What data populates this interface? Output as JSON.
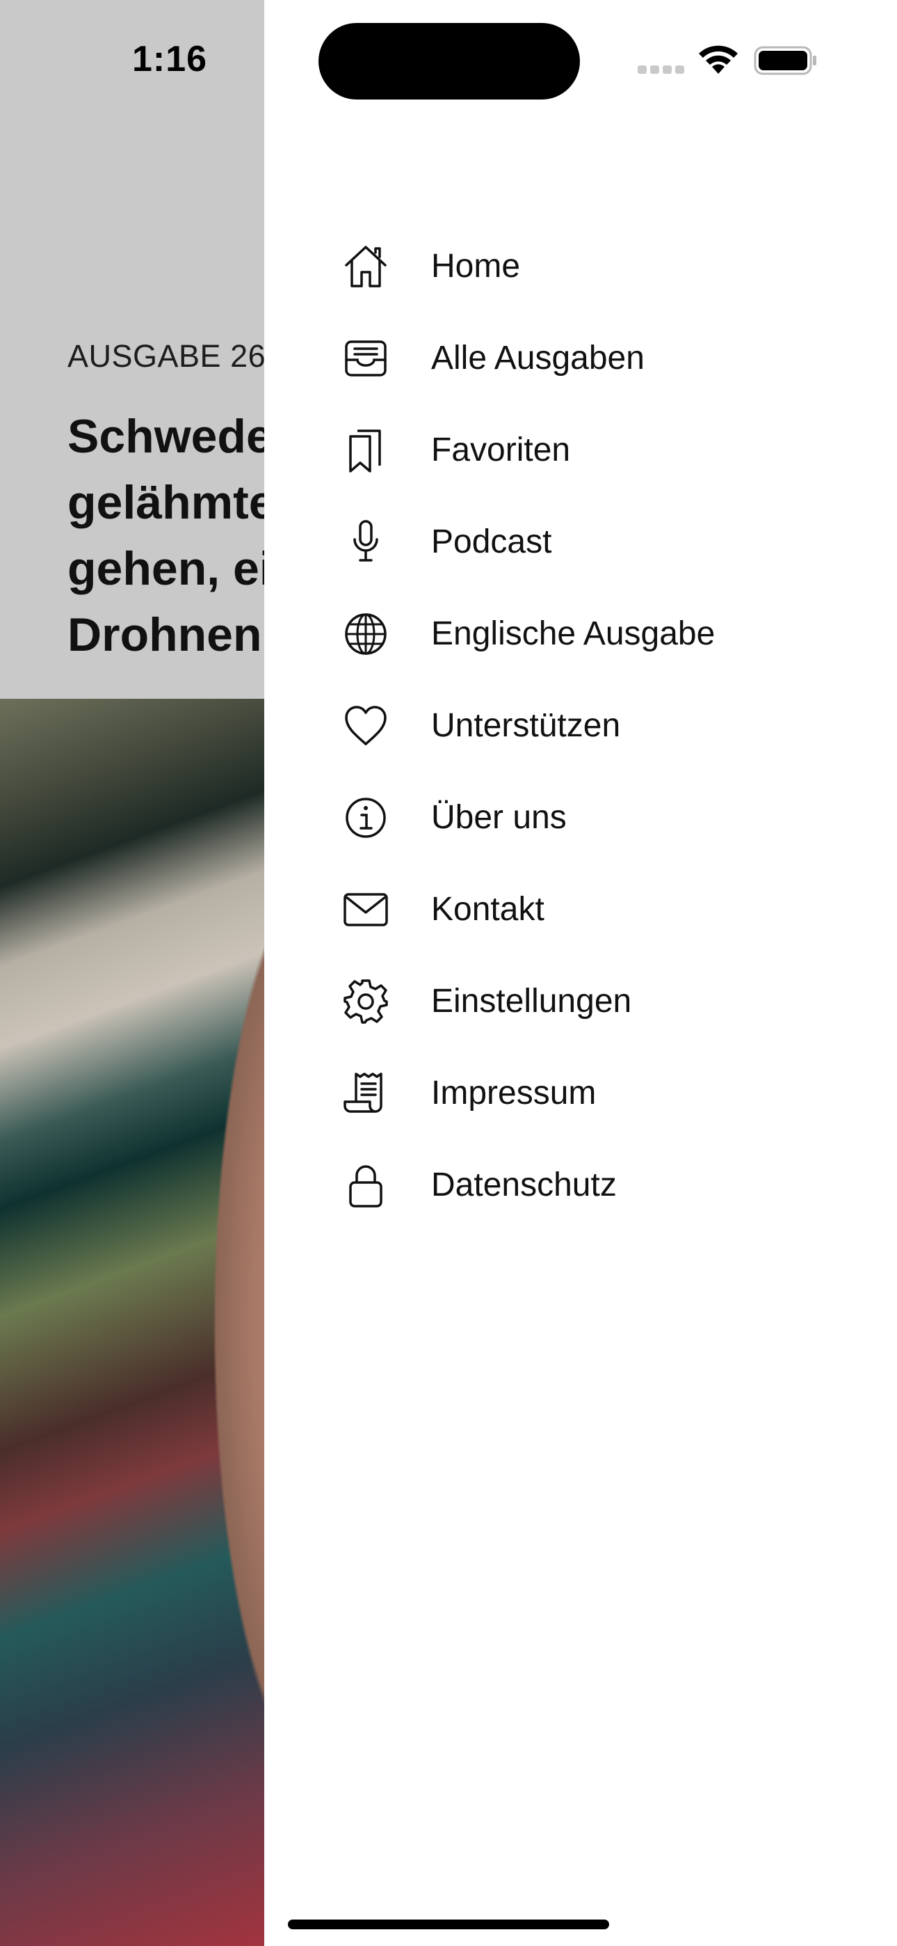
{
  "status_bar": {
    "time": "1:16"
  },
  "article": {
    "issue_label": "AUSGABE 26",
    "headline_lines": [
      "Schwede",
      "gelähmte",
      "gehen, ei",
      "Drohnen"
    ]
  },
  "menu": {
    "items": [
      {
        "label": "Home",
        "icon": "house-icon"
      },
      {
        "label": "Alle Ausgaben",
        "icon": "tray-icon"
      },
      {
        "label": "Favoriten",
        "icon": "bookmarks-icon"
      },
      {
        "label": "Podcast",
        "icon": "microphone-icon"
      },
      {
        "label": "Englische Ausgabe",
        "icon": "globe-icon"
      },
      {
        "label": "Unterstützen",
        "icon": "heart-icon"
      },
      {
        "label": "Über uns",
        "icon": "info-icon"
      },
      {
        "label": "Kontakt",
        "icon": "envelope-icon"
      },
      {
        "label": "Einstellungen",
        "icon": "gear-icon"
      },
      {
        "label": "Impressum",
        "icon": "scroll-icon"
      },
      {
        "label": "Datenschutz",
        "icon": "lock-icon"
      }
    ]
  },
  "colors": {
    "overlay_gray": "#c9c9c9",
    "text": "#111111",
    "drawer_bg": "#ffffff"
  }
}
